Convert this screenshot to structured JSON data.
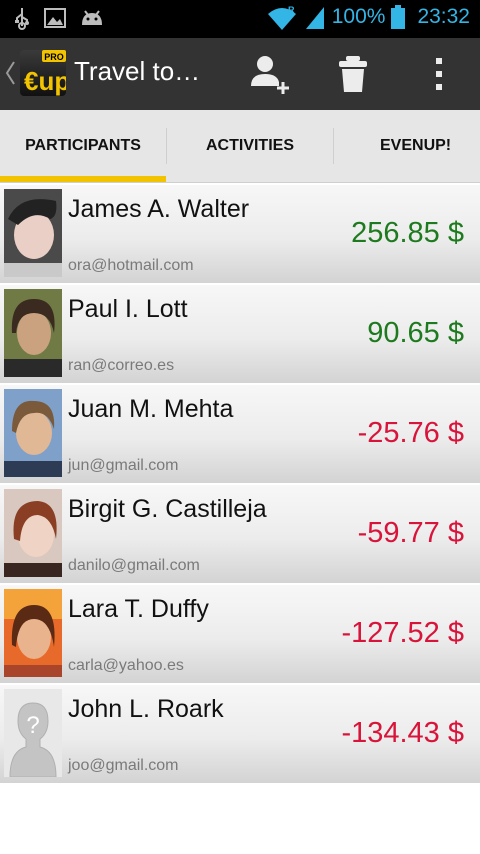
{
  "status_bar": {
    "icons": [
      "usb-icon",
      "image-icon",
      "android-icon",
      "wifi-icon",
      "signal-icon",
      "battery-icon"
    ],
    "wifi_badge": "R",
    "battery": "100%",
    "time": "23:32"
  },
  "action_bar": {
    "logo_text": "€up",
    "logo_badge": "PRO",
    "title": "Travel to…",
    "actions": [
      "add-participant-icon",
      "delete-icon",
      "overflow-menu-icon"
    ]
  },
  "tabs": [
    {
      "label": "PARTICIPANTS",
      "active": true
    },
    {
      "label": "ACTIVITIES",
      "active": false
    },
    {
      "label": "EVENUP!",
      "active": false
    }
  ],
  "colors": {
    "positive": "#1e7a1e",
    "negative": "#d9143a",
    "tab_indicator": "#f2c300",
    "status_accent": "#33b5e5"
  },
  "participants": [
    {
      "name": "James A. Walter",
      "email": "ora@hotmail.com",
      "amount": "256.85 $",
      "sign": "positive"
    },
    {
      "name": "Paul I. Lott",
      "email": "ran@correo.es",
      "amount": "90.65 $",
      "sign": "positive"
    },
    {
      "name": "Juan M. Mehta",
      "email": "jun@gmail.com",
      "amount": "-25.76 $",
      "sign": "negative"
    },
    {
      "name": "Birgit G. Castilleja",
      "email": "danilo@gmail.com",
      "amount": "-59.77 $",
      "sign": "negative"
    },
    {
      "name": "Lara T. Duffy",
      "email": "carla@yahoo.es",
      "amount": "-127.52 $",
      "sign": "negative"
    },
    {
      "name": "John L. Roark",
      "email": "joo@gmail.com",
      "amount": "-134.43 $",
      "sign": "negative"
    }
  ]
}
